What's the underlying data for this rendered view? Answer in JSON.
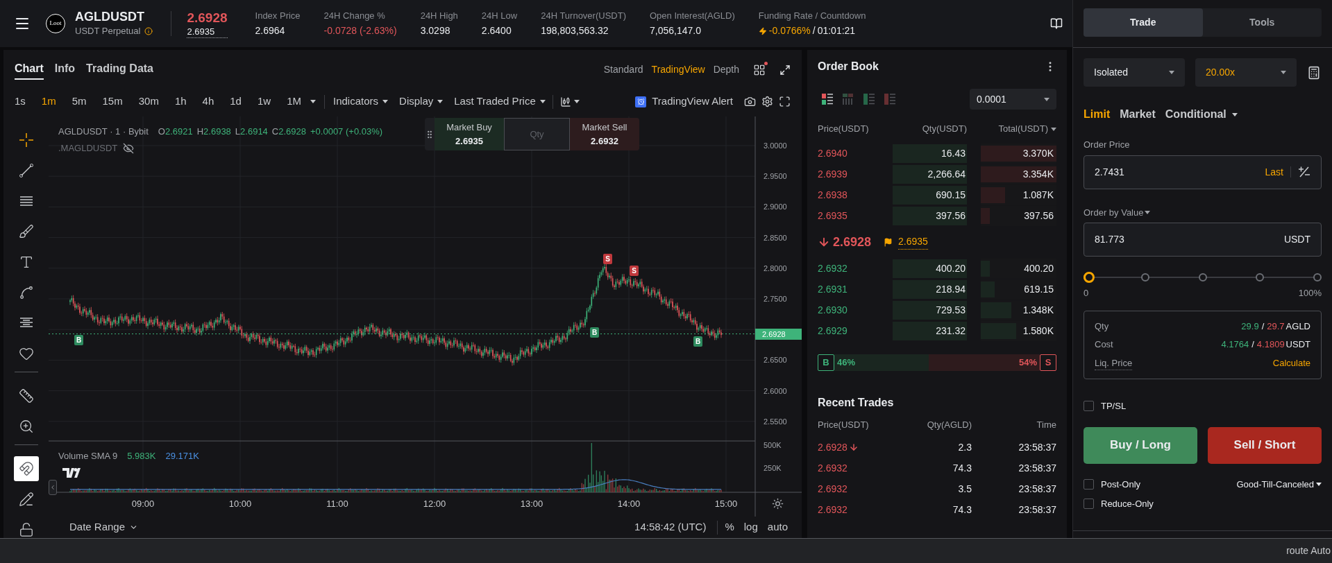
{
  "header": {
    "symbol": "AGLDUSDT",
    "logo_text": "Loot",
    "contract": "USDT Perpetual",
    "last_price": "2.6928",
    "price_falling": true,
    "mark_price": "2.6935",
    "stats": [
      {
        "label": "Index Price",
        "value": "2.6964",
        "negative": false
      },
      {
        "label": "24H Change %",
        "value": "-0.0728 (-2.63%)",
        "negative": true
      },
      {
        "label": "24H High",
        "value": "3.0298",
        "negative": false
      },
      {
        "label": "24H Low",
        "value": "2.6400",
        "negative": false
      },
      {
        "label": "24H Turnover(USDT)",
        "value": "198,803,563.32",
        "negative": false
      },
      {
        "label": "Open Interest(AGLD)",
        "value": "7,056,147.0",
        "negative": false
      }
    ],
    "funding": {
      "label": "Funding Rate / Countdown",
      "rate": "-0.0766%",
      "separator": "/",
      "countdown": "01:01:21"
    }
  },
  "chart_panel": {
    "tabs": [
      {
        "label": "Chart",
        "selected": true
      },
      {
        "label": "Info",
        "selected": false
      },
      {
        "label": "Trading Data",
        "selected": false
      }
    ],
    "views": [
      {
        "label": "Standard",
        "selected": false
      },
      {
        "label": "TradingView",
        "selected": true
      },
      {
        "label": "Depth",
        "selected": false
      }
    ],
    "intervals": [
      {
        "label": "1s",
        "selected": false
      },
      {
        "label": "1m",
        "selected": true
      },
      {
        "label": "5m",
        "selected": false
      },
      {
        "label": "15m",
        "selected": false
      },
      {
        "label": "30m",
        "selected": false
      },
      {
        "label": "1h",
        "selected": false
      },
      {
        "label": "4h",
        "selected": false
      },
      {
        "label": "1d",
        "selected": false
      },
      {
        "label": "1w",
        "selected": false
      },
      {
        "label": "1M",
        "selected": false
      }
    ],
    "menus": [
      "Indicators",
      "Display",
      "Last Traded Price"
    ],
    "alert_button": "TradingView Alert",
    "tools": [
      {
        "kind": "crosshair",
        "active": true
      },
      {
        "kind": "trend-line",
        "active": false
      },
      {
        "kind": "fib",
        "active": false
      },
      {
        "kind": "brush",
        "active": false
      },
      {
        "kind": "text",
        "active": false
      },
      {
        "kind": "pattern",
        "active": false
      },
      {
        "kind": "levels",
        "active": false
      },
      {
        "kind": "favorite",
        "active": false
      },
      {
        "kind": "divider"
      },
      {
        "kind": "ruler",
        "active": false
      },
      {
        "kind": "zoom",
        "active": false
      },
      {
        "kind": "divider"
      },
      {
        "kind": "magnet",
        "active": true
      },
      {
        "kind": "draw-lock",
        "active": false
      },
      {
        "kind": "lock",
        "active": false
      }
    ],
    "legend": {
      "title": "AGLDUSDT · 1 · Bybit",
      "ohlc": [
        {
          "label": "O",
          "value": "2.6921"
        },
        {
          "label": "H",
          "value": "2.6938"
        },
        {
          "label": "L",
          "value": "2.6914"
        },
        {
          "label": "C",
          "value": "2.6928"
        }
      ],
      "change": "+0.0007 (+0.03%)",
      "indicator": ".MAGLDUSDT"
    },
    "quick_trade": {
      "buy_label": "Market Buy",
      "buy_price": "2.6935",
      "qty_placeholder": "Qty",
      "sell_label": "Market Sell",
      "sell_price": "2.6932"
    },
    "price_axis": [
      "3.0000",
      "2.9500",
      "2.9000",
      "2.8500",
      "2.8000",
      "2.7500",
      "2.6500",
      "2.6000",
      "2.5500"
    ],
    "last_price_tag": "2.6928",
    "markers": [
      {
        "kind": "buy",
        "label": "B"
      },
      {
        "kind": "buy",
        "label": "B"
      },
      {
        "kind": "sell",
        "label": "S"
      },
      {
        "kind": "sell",
        "label": "S"
      },
      {
        "kind": "buy",
        "label": "B"
      }
    ],
    "volume": {
      "title": "Volume SMA 9",
      "value": "5.983K",
      "sma": "29.171K",
      "axis": [
        "500K",
        "250K"
      ]
    },
    "time_axis": [
      "09:00",
      "10:00",
      "11:00",
      "12:00",
      "13:00",
      "14:00",
      "15:00"
    ],
    "footer": {
      "date_range": "Date Range",
      "clock": "14:58:42 (UTC)",
      "options": [
        "%",
        "log",
        "auto"
      ]
    }
  },
  "order_book": {
    "title": "Order Book",
    "view_modes": [
      {
        "kind": "both",
        "selected": true
      },
      {
        "kind": "depth",
        "selected": false
      },
      {
        "kind": "bids",
        "selected": false
      },
      {
        "kind": "asks",
        "selected": false
      }
    ],
    "precision": "0.0001",
    "columns": [
      "Price(USDT)",
      "Qty(USDT)",
      "Total(USDT)"
    ],
    "asks": [
      {
        "price": "2.6940",
        "qty": "16.43",
        "total": "3.370K",
        "level": 1.0
      },
      {
        "price": "2.6939",
        "qty": "2,266.64",
        "total": "3.354K",
        "level": 1.0
      },
      {
        "price": "2.6938",
        "qty": "690.15",
        "total": "1.087K",
        "level": 0.32
      },
      {
        "price": "2.6935",
        "qty": "397.56",
        "total": "397.56",
        "level": 0.12
      }
    ],
    "mid": {
      "price": "2.6928",
      "falling": true,
      "mark": "2.6935"
    },
    "bids": [
      {
        "price": "2.6932",
        "qty": "400.20",
        "total": "400.20",
        "level": 0.12
      },
      {
        "price": "2.6931",
        "qty": "218.94",
        "total": "619.15",
        "level": 0.18
      },
      {
        "price": "2.6930",
        "qty": "729.53",
        "total": "1.348K",
        "level": 0.4
      },
      {
        "price": "2.6929",
        "qty": "231.32",
        "total": "1.580K",
        "level": 0.47
      }
    ],
    "ratio": {
      "buy_label": "B",
      "buy_pct": "46%",
      "sell_pct": "54%",
      "sell_label": "S",
      "level": 0.46
    }
  },
  "recent_trades": {
    "title": "Recent Trades",
    "columns": [
      "Price(USDT)",
      "Qty(AGLD)",
      "Time"
    ],
    "rows": [
      {
        "price": "2.6928",
        "qty": "2.3",
        "time": "23:58:37",
        "sell": true,
        "arrow": true
      },
      {
        "price": "2.6932",
        "qty": "74.3",
        "time": "23:58:37",
        "sell": true,
        "arrow": false
      },
      {
        "price": "2.6932",
        "qty": "3.5",
        "time": "23:58:37",
        "sell": true,
        "arrow": false
      },
      {
        "price": "2.6932",
        "qty": "74.3",
        "time": "23:58:37",
        "sell": true,
        "arrow": false
      }
    ]
  },
  "trade_panel": {
    "tabs": [
      {
        "label": "Trade",
        "selected": true
      },
      {
        "label": "Tools",
        "selected": false
      }
    ],
    "margin_mode": "Isolated",
    "leverage": "20.00x",
    "order_types": [
      {
        "label": "Limit",
        "selected": true,
        "dropdown": false
      },
      {
        "label": "Market",
        "selected": false,
        "dropdown": false
      },
      {
        "label": "Conditional",
        "selected": false,
        "dropdown": true
      }
    ],
    "price_label": "Order Price",
    "price_value": "2.7431",
    "price_source": "Last",
    "value_label": "Order by Value",
    "value_value": "81.773",
    "value_unit": "USDT",
    "slider": {
      "level": 0,
      "min_label": "0",
      "max_label": "100%"
    },
    "summary": [
      {
        "kind": "pair",
        "label": "Qty",
        "buy": "29.9",
        "separator": "/",
        "sell": "29.7",
        "unit": "AGLD"
      },
      {
        "kind": "pair",
        "label": "Cost",
        "buy": "4.1764",
        "separator": "/",
        "sell": "4.1809",
        "unit": "USDT"
      },
      {
        "kind": "link",
        "label": "Liq. Price",
        "action": "Calculate"
      }
    ],
    "tpsl": {
      "label": "TP/SL",
      "checked": false
    },
    "buy_button": "Buy / Long",
    "sell_button": "Sell / Short",
    "options": [
      {
        "label": "Post-Only",
        "checked": false
      },
      {
        "label": "Reduce-Only",
        "checked": false
      }
    ],
    "time_in_force": "Good-Till-Canceled"
  },
  "status_bar": {
    "text": "route Auto"
  }
}
